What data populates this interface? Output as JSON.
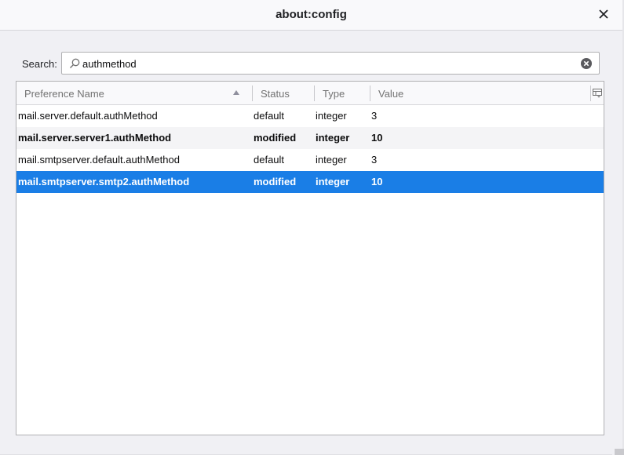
{
  "window": {
    "title": "about:config"
  },
  "search": {
    "label": "Search:",
    "value": "authmethod"
  },
  "table": {
    "columns": [
      "Preference Name",
      "Status",
      "Type",
      "Value"
    ],
    "sorted_column": "Preference Name",
    "rows": [
      {
        "name": "mail.server.default.authMethod",
        "status": "default",
        "type": "integer",
        "value": "3",
        "modified": false,
        "selected": false
      },
      {
        "name": "mail.server.server1.authMethod",
        "status": "modified",
        "type": "integer",
        "value": "10",
        "modified": true,
        "selected": false
      },
      {
        "name": "mail.smtpserver.default.authMethod",
        "status": "default",
        "type": "integer",
        "value": "3",
        "modified": false,
        "selected": false
      },
      {
        "name": "mail.smtpserver.smtp2.authMethod",
        "status": "modified",
        "type": "integer",
        "value": "10",
        "modified": true,
        "selected": true
      }
    ]
  },
  "icons": {
    "close": "close-icon",
    "search": "search-icon",
    "clear": "clear-search-icon",
    "sort": "sort-ascending-icon",
    "column_picker": "column-picker-icon"
  },
  "colors": {
    "selection": "#1a7ee6",
    "alt_row": "#f4f4f6"
  }
}
